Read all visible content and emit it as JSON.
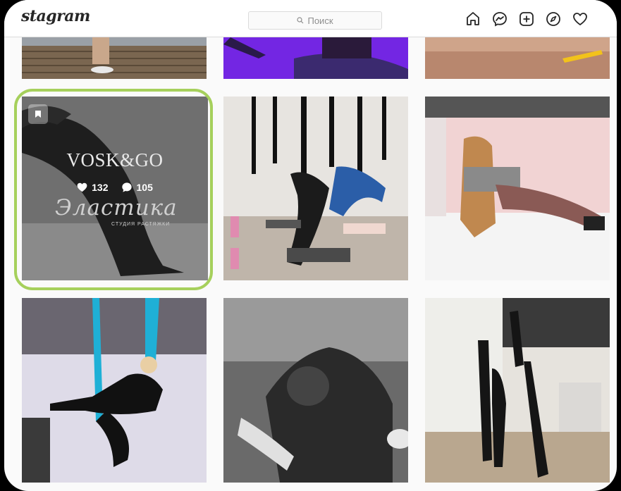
{
  "header": {
    "logo": "stagram",
    "search_placeholder": "Поиск"
  },
  "nav_icons": [
    "home-icon",
    "messenger-icon",
    "new-post-icon",
    "explore-icon",
    "heart-icon"
  ],
  "highlighted_post": {
    "brand": "VOSK&GO",
    "likes": "132",
    "comments": "105",
    "script_title": "Эластика",
    "subtitle": "СТУДИЯ РАСТЯЖКИ"
  },
  "colors": {
    "highlight_border": "#a6d05c",
    "accent": "#262626"
  }
}
